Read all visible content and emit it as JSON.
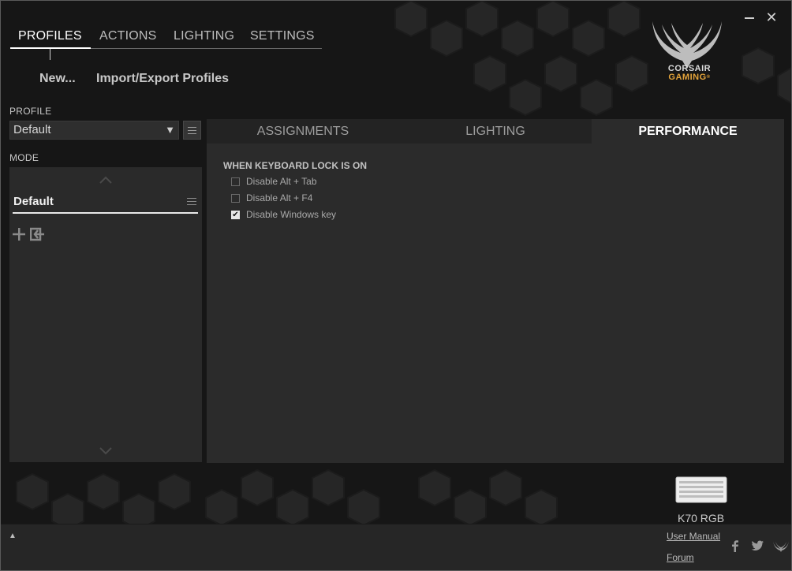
{
  "nav": {
    "tabs": [
      "PROFILES",
      "ACTIONS",
      "LIGHTING",
      "SETTINGS"
    ],
    "active": "PROFILES"
  },
  "profile_actions": {
    "new": "New...",
    "import_export": "Import/Export Profiles"
  },
  "logo": {
    "line1": "CORSAIR",
    "line2": "GAMING",
    "mark": "®"
  },
  "profile": {
    "label": "PROFILE",
    "selected": "Default"
  },
  "mode": {
    "label": "MODE",
    "items": [
      "Default"
    ]
  },
  "main": {
    "tabs": [
      "ASSIGNMENTS",
      "LIGHTING",
      "PERFORMANCE"
    ],
    "active_tab": "PERFORMANCE",
    "section_title": "WHEN KEYBOARD LOCK IS ON",
    "options": [
      {
        "label": "Disable Alt + Tab",
        "checked": false
      },
      {
        "label": "Disable Alt + F4",
        "checked": false
      },
      {
        "label": "Disable Windows key",
        "checked": true
      }
    ]
  },
  "device": {
    "name": "K70 RGB"
  },
  "footer": {
    "user_manual": "User Manual",
    "forum": "Forum"
  },
  "colors": {
    "accent": "#e3a33a",
    "panel": "#2b2b2b",
    "background": "#161616"
  }
}
